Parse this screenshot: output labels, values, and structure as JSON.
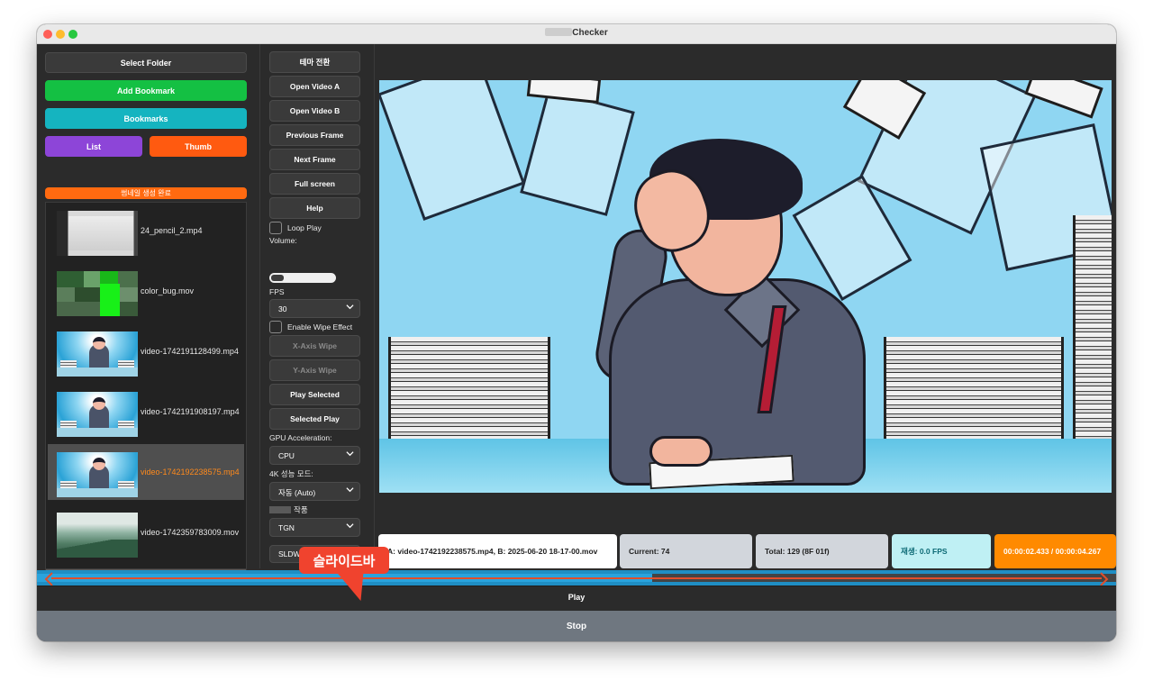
{
  "window": {
    "title_suffix": "Checker"
  },
  "left_panel": {
    "select_folder": "Select Folder",
    "add_bookmark": "Add Bookmark",
    "bookmarks": "Bookmarks",
    "list": "List",
    "thumb": "Thumb",
    "progress_text": "썸네일 생성 완료",
    "files": [
      {
        "name": "24_pencil_2.mp4",
        "thumb": "whiteboard"
      },
      {
        "name": "color_bug.mov",
        "thumb": "color-blocks"
      },
      {
        "name": "video-1742191128499.mp4",
        "thumb": "stressed-man"
      },
      {
        "name": "video-1742191908197.mp4",
        "thumb": "stressed-man"
      },
      {
        "name": "video-1742192238575.mp4",
        "thumb": "stressed-man",
        "selected": true
      },
      {
        "name": "video-1742359783009.mov",
        "thumb": "mountains"
      }
    ]
  },
  "mid_panel": {
    "theme_toggle": "테마 전환",
    "open_a": "Open Video A",
    "open_b": "Open Video B",
    "prev_frame": "Previous Frame",
    "next_frame": "Next Frame",
    "full_screen": "Full screen",
    "help": "Help",
    "loop_play": "Loop Play",
    "volume_label": "Volume:",
    "volume_level": 0.2,
    "fps_label": "FPS",
    "fps_value": "30",
    "enable_wipe": "Enable Wipe Effect",
    "x_wipe": "X-Axis Wipe",
    "y_wipe": "Y-Axis Wipe",
    "play_selected": "Play Selected",
    "selected_play": "Selected Play",
    "gpu_label": "GPU Acceleration:",
    "gpu_value": "CPU",
    "mode_label": "4K 성능 모드:",
    "mode_value": "자동 (Auto)",
    "work_label": "작품",
    "work_value": "TGN",
    "last_value": "SLDW2T"
  },
  "status": {
    "files": "A: video-1742192238575.mp4, B: 2025-06-20 18-17-00.mov",
    "current": "Current: 74",
    "total": "Total: 129 (8F 01f)",
    "playback": "재생: 0.0 FPS",
    "time": "00:00:02.433 / 00:00:04.267"
  },
  "seek": {
    "progress": 0.57
  },
  "controls": {
    "play": "Play",
    "stop": "Stop"
  },
  "annotation": {
    "callout": "슬라이드바"
  },
  "colors": {
    "green": "#14c043",
    "teal": "#15b4c0",
    "purple": "#8d45d8",
    "orange": "#ff5a10",
    "accent_callout": "#f0432e"
  }
}
